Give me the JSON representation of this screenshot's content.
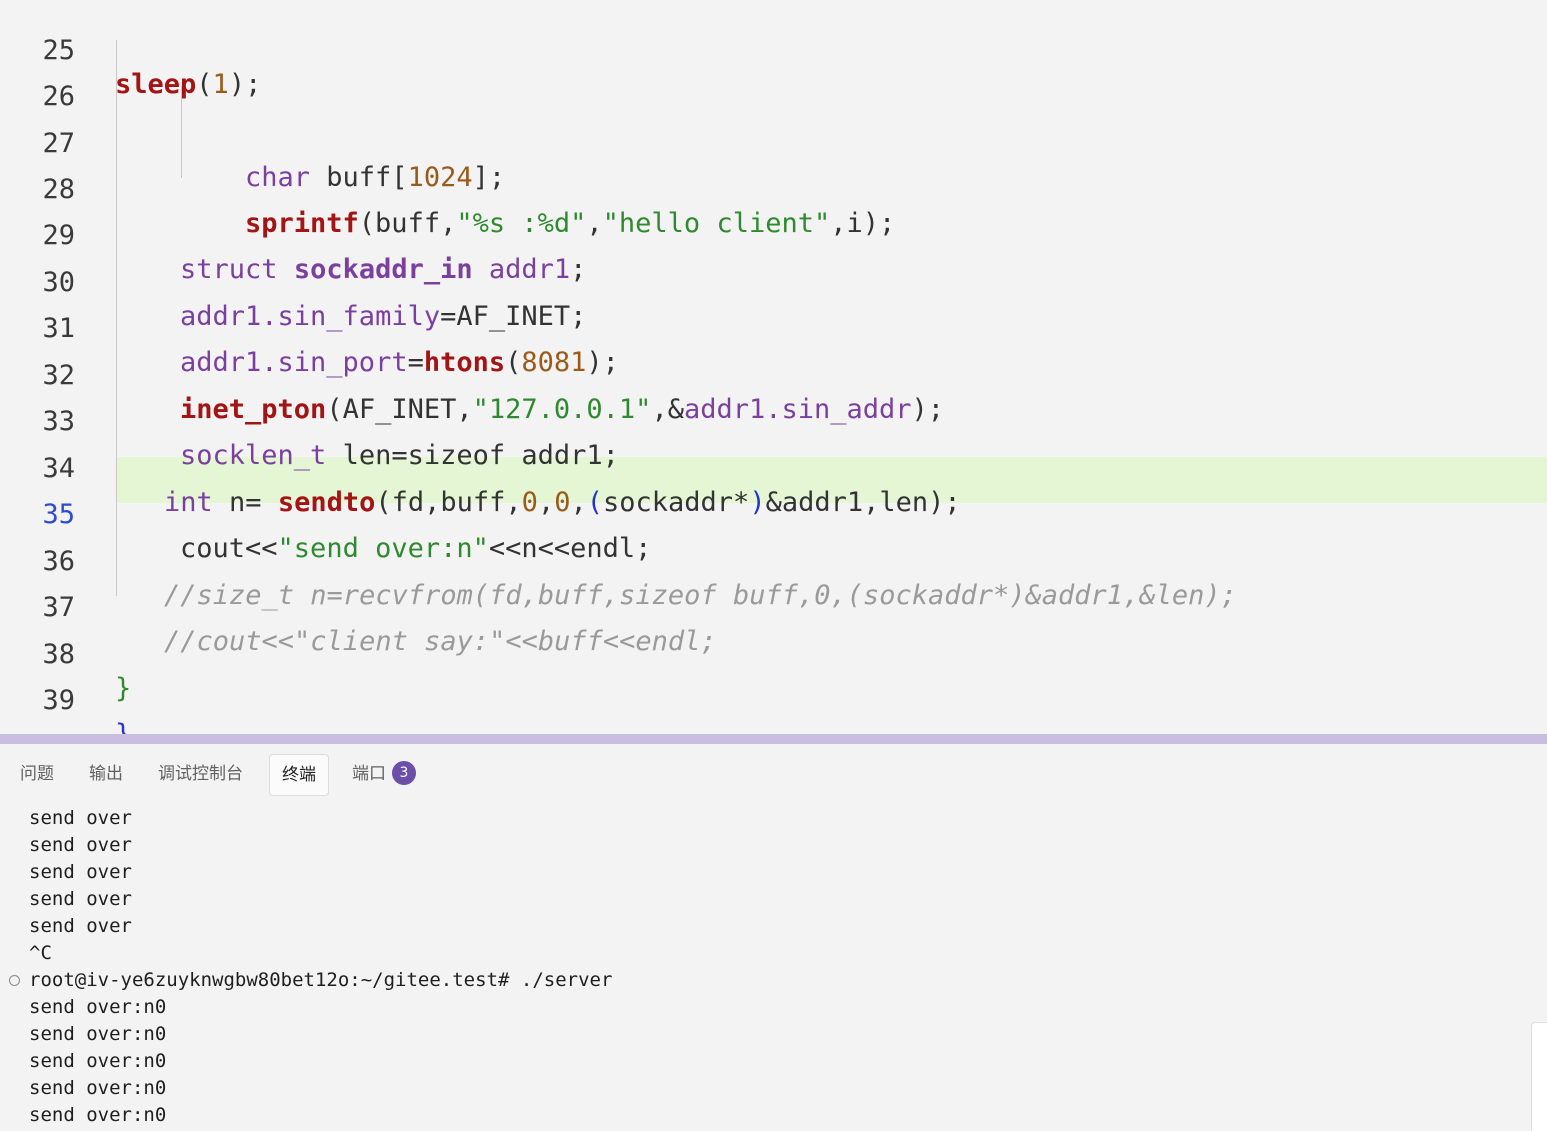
{
  "editor": {
    "lines": [
      {
        "num": "25"
      },
      {
        "num": "26"
      },
      {
        "num": "27"
      },
      {
        "num": "28"
      },
      {
        "num": "29"
      },
      {
        "num": "30"
      },
      {
        "num": "31"
      },
      {
        "num": "32"
      },
      {
        "num": "33"
      },
      {
        "num": "34"
      },
      {
        "num": "35"
      },
      {
        "num": "36"
      },
      {
        "num": "37"
      },
      {
        "num": "38"
      },
      {
        "num": "39"
      }
    ],
    "current_line": "35",
    "code": {
      "l25": {
        "fn": "sleep",
        "open": "(",
        "num": "1",
        "close": ");"
      },
      "l27": {
        "kw": "char",
        "rest": " buff[",
        "num": "1024",
        "close": "];"
      },
      "l28": {
        "fn": "sprintf",
        "a": "(buff,",
        "s1": "\"%s :%d\"",
        "comma": ",",
        "s2": "\"hello client\"",
        "b": ",i);"
      },
      "l29": {
        "kw": "struct",
        "type": "sockaddr_in",
        "var": "addr1",
        "end": ";"
      },
      "l30": {
        "var": "addr1.sin_family",
        "eq": "=",
        "rest": "AF_INET;"
      },
      "l31": {
        "var": "addr1.sin_port",
        "eq": "=",
        "fn": "htons",
        "open": "(",
        "num": "8081",
        "close": ");"
      },
      "l32": {
        "fn": "inet_pton",
        "a": "(AF_INET,",
        "s": "\"127.0.0.1\"",
        "b": ",&",
        "var": "addr1.sin_addr",
        "c": ");"
      },
      "l33": {
        "kw": "socklen_t",
        "rest": " len=sizeof addr1;"
      },
      "l34": {
        "kw": "int",
        "a": " n= ",
        "fn": "sendto",
        "b": "(fd,buff,",
        "n1": "0",
        "c": ",",
        "n2": "0",
        "d": ",",
        "p1": "(",
        "e": "sockaddr*",
        "p2": ")",
        "f": "&addr1,len);"
      },
      "l35": {
        "a": "cout<<",
        "s": "\"send over:n\"",
        "b": "<<n<<endl;"
      },
      "l36": {
        "cmt": "//size_t n=recvfrom(fd,buff,sizeof buff,0,(sockaddr*)&addr1,&len);"
      },
      "l37": {
        "cmt": "//cout<<\"client say:\"<<buff<<endl;"
      },
      "l38": {
        "brace": "}"
      },
      "l39": {
        "brace": "}"
      }
    }
  },
  "panel": {
    "tabs": [
      {
        "label": "问题"
      },
      {
        "label": "输出"
      },
      {
        "label": "调试控制台"
      },
      {
        "label": "终端",
        "active": true
      },
      {
        "label": "端口",
        "badge": "3"
      }
    ],
    "terminal_lines": [
      "send over",
      "send over",
      "send over",
      "send over",
      "send over",
      "^C",
      "root@iv-ye6zuyknwgbw80bet12o:~/gitee.test# ./server",
      "send over:n0",
      "send over:n0",
      "send over:n0",
      "send over:n0",
      "send over:n0"
    ]
  },
  "colors": {
    "current_line_bg": "#e4f6d4",
    "divider": "#c9bedf",
    "badge": "#6b4fa8"
  }
}
